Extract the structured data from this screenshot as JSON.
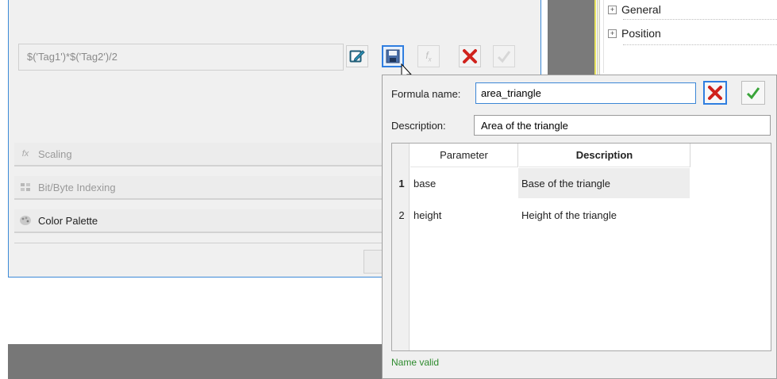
{
  "background_dialog": {
    "formula_expression": "$('Tag1')*$('Tag2')/2",
    "sections": [
      {
        "label": "Scaling",
        "icon": "fx-icon",
        "enabled": false
      },
      {
        "label": "Bit/Byte Indexing",
        "icon": "bit-indexing-icon",
        "enabled": false
      },
      {
        "label": "Color Palette",
        "icon": "palette-icon",
        "enabled": true
      }
    ],
    "toolbar": {
      "edit_icon": "edit-icon",
      "save_icon": "save-icon",
      "function_icon": "function-icon",
      "delete_icon": "delete-icon",
      "apply_icon": "check-icon"
    }
  },
  "property_tree": {
    "items": [
      {
        "label": "General",
        "expand": "⊞"
      },
      {
        "label": "Position",
        "expand": "⊞"
      }
    ]
  },
  "formula_popup": {
    "formula_name_label": "Formula name:",
    "formula_name_value": "area_triangle",
    "description_label": "Description:",
    "description_value": "Area of the triangle",
    "table": {
      "headers": [
        "Parameter",
        "Description"
      ],
      "rows": [
        {
          "index": "1",
          "parameter": "base",
          "description": "Base of the triangle"
        },
        {
          "index": "2",
          "parameter": "height",
          "description": "Height of the triangle"
        }
      ]
    },
    "status": "Name valid",
    "colors": {
      "accent": "#2f7ee0",
      "valid": "#2e8b2e",
      "cancel": "#d0221c",
      "ok": "#3aa43a"
    }
  }
}
